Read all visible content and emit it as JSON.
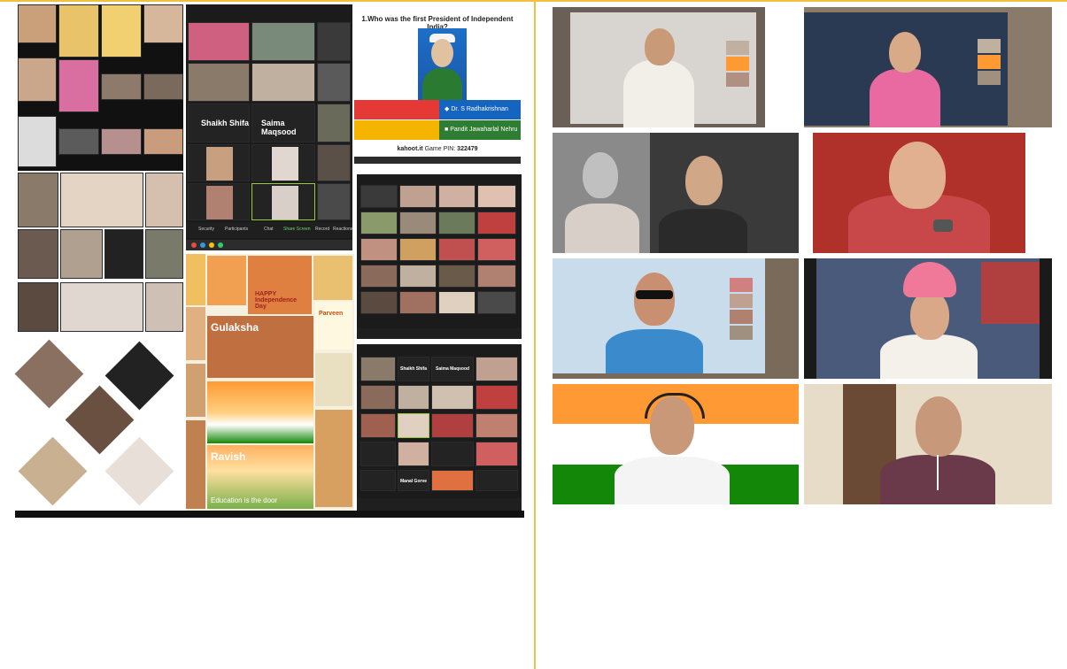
{
  "quiz": {
    "question": "1.Who was the first President of Independent India?",
    "answers": [
      {
        "label": "Dr. S Radhakrishnan",
        "icon": "diamond-icon",
        "color": "#1565c0"
      },
      {
        "label": "Pandit Jawaharlal Nehru",
        "icon": "square-icon",
        "color": "#2e7d32"
      }
    ],
    "answer_colors_left": [
      "#e53935",
      "#f4b400"
    ],
    "site": "kahoot.it",
    "pin_label": "Game PIN:",
    "pin": "322479"
  },
  "meeting_1": {
    "names": [
      "Shaikh Shifa",
      "Saima Maqsood"
    ],
    "toolbar_items": [
      "Security",
      "Participants",
      "Chat",
      "Share Screen",
      "Record",
      "Reactions"
    ]
  },
  "meeting_2": {
    "names": [
      "Shaikh Shifa",
      "Saima Maqsood",
      "Manal Gorve"
    ]
  },
  "paintings": {
    "labels": [
      "Gulaksha",
      "Ravish",
      "Parveen"
    ],
    "caption": "Education is the door",
    "greeting": "HAPPY Independence Day"
  },
  "colors": {
    "saffron": "#ff9933",
    "white": "#ffffff",
    "green": "#138808",
    "divider": "#f0c040"
  }
}
